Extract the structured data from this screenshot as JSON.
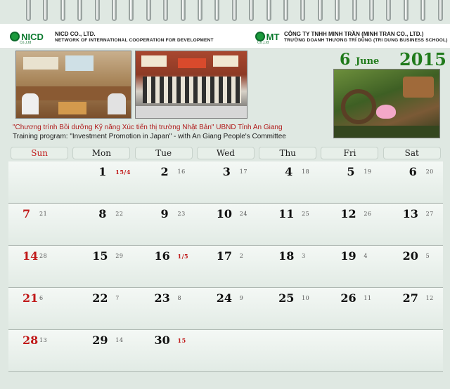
{
  "header": {
    "left_org_logo": "NICD",
    "left_org_logo_sub": "Co.,Ltd",
    "left_org_name": "NICD CO., LTD.",
    "left_org_sub": "NETWORK OF INTERNATIONAL COOPERATION FOR DEVELOPMENT",
    "right_org_logo": "MT",
    "right_org_logo_sub": "Co.,Ltd",
    "right_org_name": "CÔNG TY TNHH MINH TRẦN (MINH TRAN CO., LTD.)",
    "right_org_sub": "TRƯỜNG DOANH THƯƠNG TRÍ DŨNG (TRI DUNG BUSINESS SCHOOL)"
  },
  "captions": {
    "vi": "\"Chương trình Bồi dưỡng Kỹ năng Xúc tiến thị trường Nhật Bản\" UBND Tỉnh An Giang",
    "en": "Training program: \"Investment Promotion in Japan\" - with An Giang People's Committee"
  },
  "month": {
    "number": "6",
    "name": "June",
    "year": "2015"
  },
  "weekdays": [
    "Sun",
    "Mon",
    "Tue",
    "Wed",
    "Thu",
    "Fri",
    "Sat"
  ],
  "weeks": [
    [
      {
        "d": "",
        "l": ""
      },
      {
        "d": "1",
        "l": "15/4",
        "red": true
      },
      {
        "d": "2",
        "l": "16"
      },
      {
        "d": "3",
        "l": "17"
      },
      {
        "d": "4",
        "l": "18"
      },
      {
        "d": "5",
        "l": "19"
      },
      {
        "d": "6",
        "l": "20"
      }
    ],
    [
      {
        "d": "7",
        "l": "21"
      },
      {
        "d": "8",
        "l": "22"
      },
      {
        "d": "9",
        "l": "23"
      },
      {
        "d": "10",
        "l": "24"
      },
      {
        "d": "11",
        "l": "25"
      },
      {
        "d": "12",
        "l": "26"
      },
      {
        "d": "13",
        "l": "27"
      }
    ],
    [
      {
        "d": "14",
        "l": "28"
      },
      {
        "d": "15",
        "l": "29"
      },
      {
        "d": "16",
        "l": "1/5",
        "red": true
      },
      {
        "d": "17",
        "l": "2"
      },
      {
        "d": "18",
        "l": "3"
      },
      {
        "d": "19",
        "l": "4"
      },
      {
        "d": "20",
        "l": "5"
      }
    ],
    [
      {
        "d": "21",
        "l": "6"
      },
      {
        "d": "22",
        "l": "7"
      },
      {
        "d": "23",
        "l": "8"
      },
      {
        "d": "24",
        "l": "9"
      },
      {
        "d": "25",
        "l": "10"
      },
      {
        "d": "26",
        "l": "11"
      },
      {
        "d": "27",
        "l": "12"
      }
    ],
    [
      {
        "d": "28",
        "l": "13"
      },
      {
        "d": "29",
        "l": "14"
      },
      {
        "d": "30",
        "l": "15",
        "red": true
      },
      {
        "d": "",
        "l": ""
      },
      {
        "d": "",
        "l": ""
      },
      {
        "d": "",
        "l": ""
      },
      {
        "d": "",
        "l": ""
      }
    ]
  ],
  "colors": {
    "accent": "#1f7a1a",
    "sunday": "#c01818",
    "background": "#dfe8e2"
  }
}
